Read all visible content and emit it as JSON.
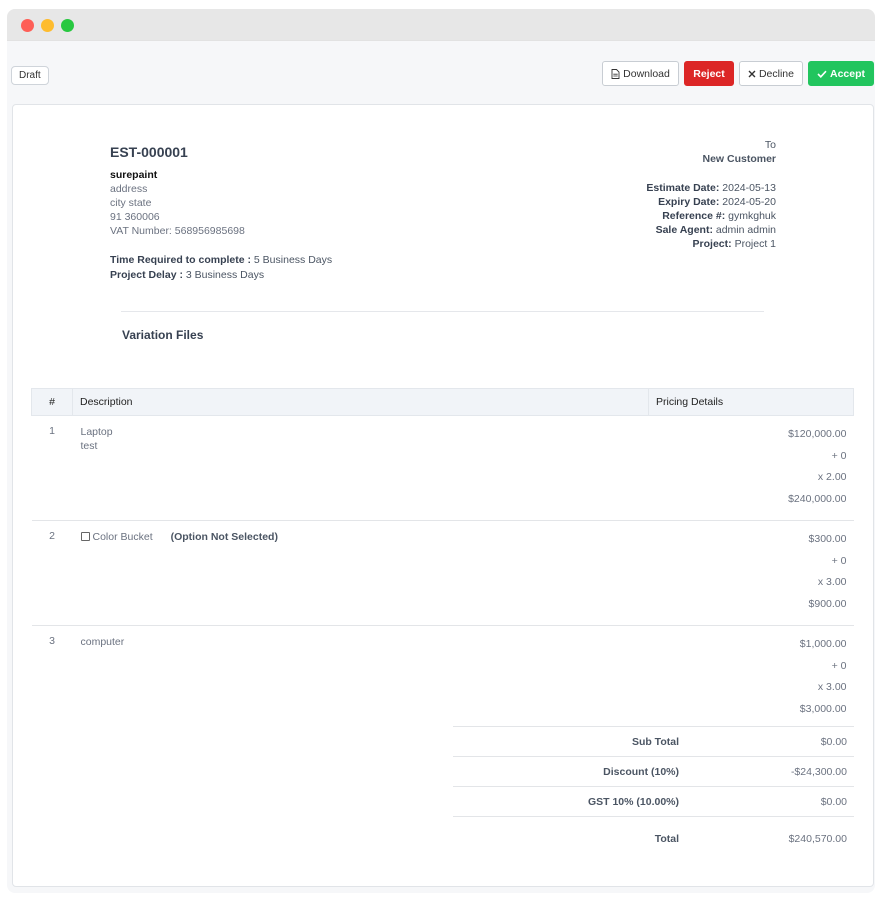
{
  "status_badge": "Draft",
  "toolbar": {
    "download_label": "Download",
    "reject_label": "Reject",
    "decline_label": "Decline",
    "accept_label": "Accept"
  },
  "estimate": {
    "number": "EST-000001",
    "company": {
      "name": "surepaint",
      "address": "address",
      "city_state": "city state",
      "zip": "91 360006",
      "vat": "VAT Number: 568956985698"
    },
    "time_required_label": "Time Required to complete :",
    "time_required_value": "5 Business Days",
    "project_delay_label": "Project Delay :",
    "project_delay_value": "3 Business Days",
    "to_label": "To",
    "to_name": "New Customer",
    "estimate_date_label": "Estimate Date:",
    "estimate_date": "2024-05-13",
    "expiry_date_label": "Expiry Date:",
    "expiry_date": "2024-05-20",
    "reference_label": "Reference #:",
    "reference": "gymkghuk",
    "sale_agent_label": "Sale Agent:",
    "sale_agent": "admin admin",
    "project_label": "Project:",
    "project": "Project 1",
    "variation_files_title": "Variation Files"
  },
  "table": {
    "headers": {
      "num": "#",
      "description": "Description",
      "pricing": "Pricing Details"
    },
    "rows": [
      {
        "num": "1",
        "name": "Laptop",
        "detail": "test",
        "rate": "$120,000.00",
        "tax": "+ 0",
        "qty": "x 2.00",
        "amount": "$240,000.00"
      },
      {
        "num": "2",
        "name": "Color Bucket",
        "note": "(Option Not Selected)",
        "rate": "$300.00",
        "tax": "+ 0",
        "qty": "x 3.00",
        "amount": "$900.00"
      },
      {
        "num": "3",
        "name": "computer",
        "rate": "$1,000.00",
        "tax": "+ 0",
        "qty": "x 3.00",
        "amount": "$3,000.00"
      }
    ]
  },
  "totals": {
    "subtotal_label": "Sub Total",
    "subtotal": "$0.00",
    "discount_label": "Discount (10%)",
    "discount": "-$24,300.00",
    "gst_label": "GST 10% (10.00%)",
    "gst": "$0.00",
    "total_label": "Total",
    "total": "$240,570.00"
  }
}
